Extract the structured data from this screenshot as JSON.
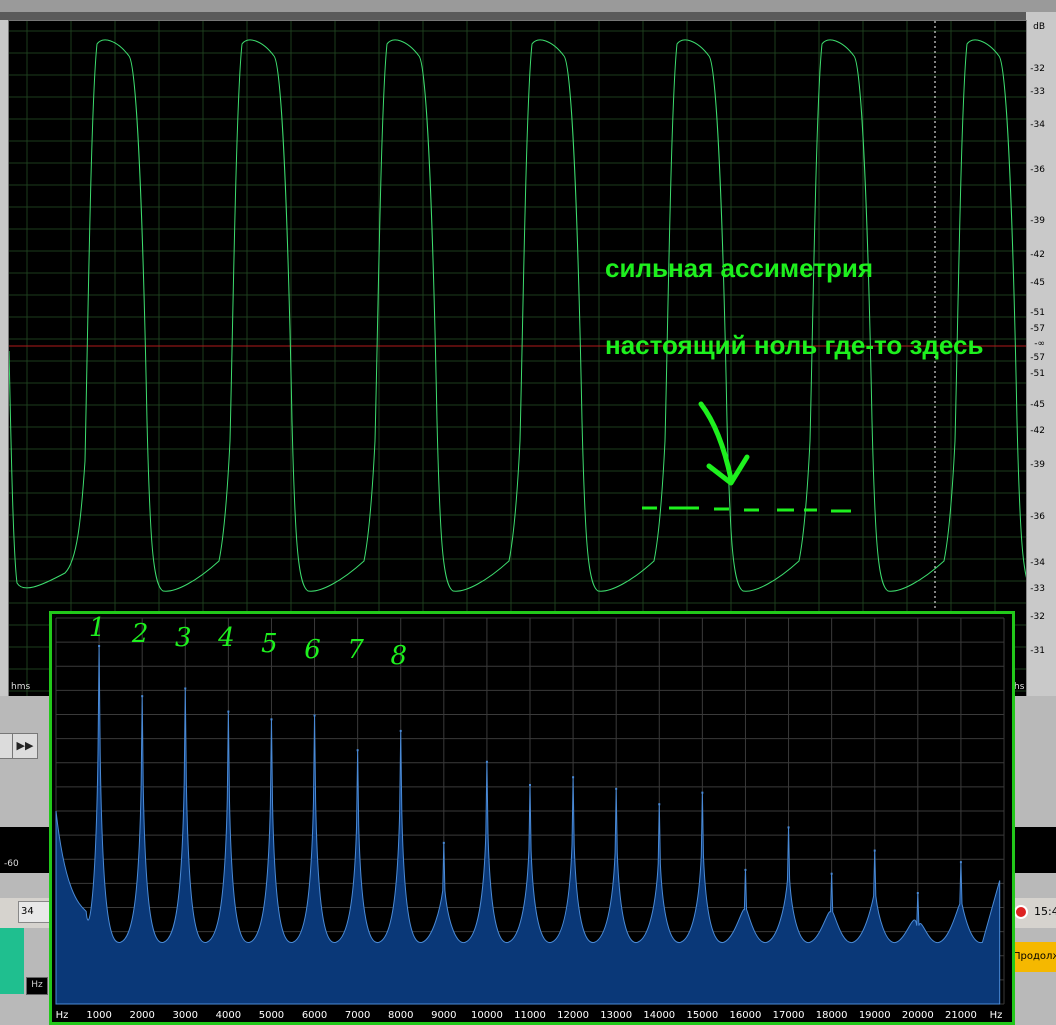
{
  "waveform": {
    "time_unit_left": "hms",
    "time_unit_right": "hs",
    "db_unit": "dB",
    "db_scale": [
      "-32",
      "-33",
      "-34",
      "-36",
      "-39",
      "-42",
      "-45",
      "-51",
      "-57",
      "-∞",
      "-57",
      "-51",
      "-45",
      "-42",
      "-39",
      "-36",
      "-34",
      "-33",
      "-32",
      "-31"
    ],
    "trace_color": "#3ddc6e",
    "zero_line_color": "#b01a1a",
    "periods": 7
  },
  "annotations": {
    "asymmetry": "сильная ассиметрия",
    "true_zero": "настоящий ноль где-то здесь"
  },
  "spectrum": {
    "freq_unit": "Hz",
    "fill_color": "#0a3878",
    "edge_color": "#4a8ad6",
    "frame_color": "#22c81a",
    "harmonic_marks": [
      "1",
      "2",
      "3",
      "4",
      "5",
      "6",
      "7",
      "8"
    ]
  },
  "transport": {
    "play_icon": "▶▶"
  },
  "ruler_lower": {
    "label": "-60"
  },
  "taskbar": {
    "task_label": "34",
    "clock": "15:4",
    "balloon_text": "Продолжи",
    "hz_box": "Hz"
  },
  "chart_data": {
    "type": "area",
    "title": "",
    "xlabel": "Hz",
    "ylabel": "",
    "xlim": [
      0,
      22000
    ],
    "x_ticks": [
      1000,
      2000,
      3000,
      4000,
      5000,
      6000,
      7000,
      8000,
      9000,
      10000,
      11000,
      12000,
      13000,
      14000,
      15000,
      16000,
      17000,
      18000,
      19000,
      20000,
      21000
    ],
    "peaks": {
      "freq_hz": [
        1000,
        2000,
        3000,
        4000,
        5000,
        6000,
        7000,
        8000,
        9000,
        10000,
        11000,
        12000,
        13000,
        14000,
        15000,
        16000,
        17000,
        18000,
        19000,
        20000,
        21000
      ],
      "relative_level": [
        0.93,
        0.8,
        0.82,
        0.76,
        0.74,
        0.75,
        0.66,
        0.71,
        0.42,
        0.63,
        0.57,
        0.59,
        0.56,
        0.52,
        0.55,
        0.35,
        0.46,
        0.34,
        0.4,
        0.29,
        0.37
      ]
    }
  }
}
